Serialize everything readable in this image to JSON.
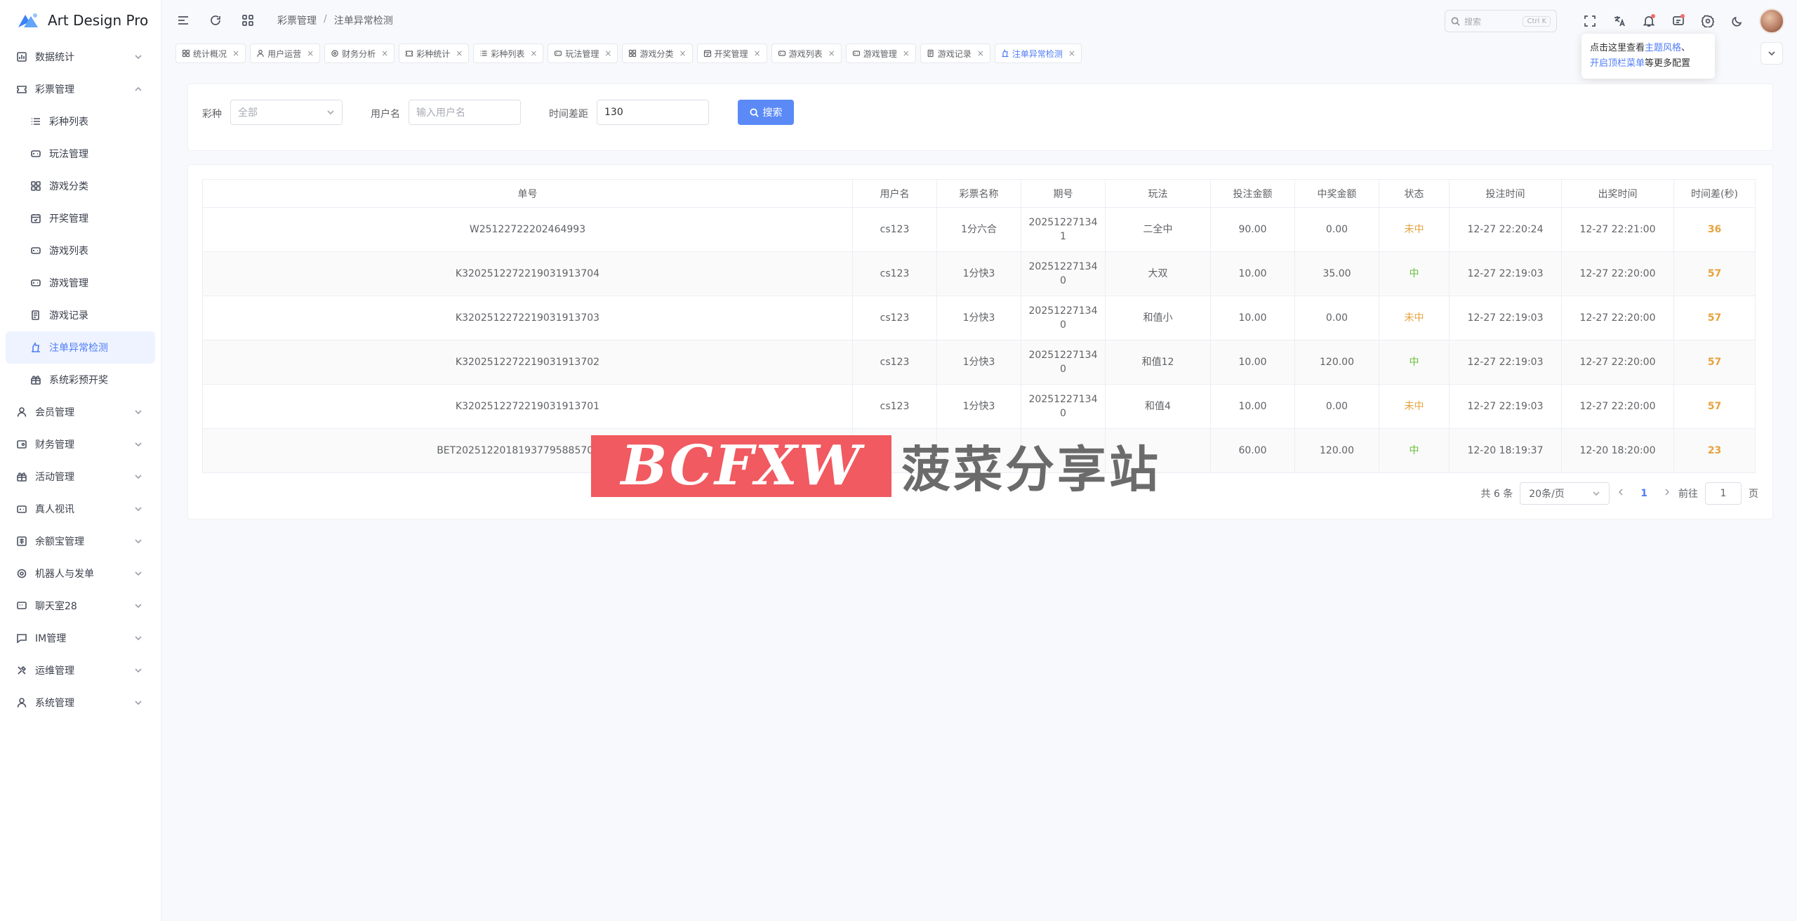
{
  "app": {
    "title": "Art Design Pro"
  },
  "colors": {
    "accent": "#4f7cf7",
    "win": "#67c23a",
    "lose": "#e6a23c"
  },
  "sidebar": {
    "items": [
      {
        "label": "数据统计",
        "icon": "chart-icon",
        "expandable": true
      },
      {
        "label": "彩票管理",
        "icon": "ticket-icon",
        "expandable": true,
        "expanded": true
      },
      {
        "label": "会员管理",
        "icon": "user-icon",
        "expandable": true
      },
      {
        "label": "财务管理",
        "icon": "wallet-icon",
        "expandable": true
      },
      {
        "label": "活动管理",
        "icon": "gift-icon",
        "expandable": true
      },
      {
        "label": "真人视讯",
        "icon": "video-icon",
        "expandable": true
      },
      {
        "label": "余额宝管理",
        "icon": "bank-icon",
        "expandable": true
      },
      {
        "label": "机器人与发单",
        "icon": "robot-icon",
        "expandable": true
      },
      {
        "label": "聊天室28",
        "icon": "chat-icon",
        "expandable": true
      },
      {
        "label": "IM管理",
        "icon": "message-icon",
        "expandable": true
      },
      {
        "label": "运维管理",
        "icon": "tools-icon",
        "expandable": true
      },
      {
        "label": "系统管理",
        "icon": "user-icon",
        "expandable": true
      }
    ],
    "sub_items": [
      {
        "label": "彩种列表",
        "icon": "list-icon"
      },
      {
        "label": "玩法管理",
        "icon": "gamepad-icon"
      },
      {
        "label": "游戏分类",
        "icon": "grid-icon"
      },
      {
        "label": "开奖管理",
        "icon": "calendar-icon"
      },
      {
        "label": "游戏列表",
        "icon": "gamepad-icon"
      },
      {
        "label": "游戏管理",
        "icon": "gamepad-icon"
      },
      {
        "label": "游戏记录",
        "icon": "record-icon"
      },
      {
        "label": "注单异常检测",
        "icon": "alert-icon",
        "active": true
      },
      {
        "label": "系统彩预开奖",
        "icon": "gift-icon"
      }
    ]
  },
  "header": {
    "breadcrumb": [
      "彩票管理",
      "注单异常检测"
    ],
    "breadcrumb_sep": "/",
    "search_placeholder": "搜索",
    "search_shortcut": "Ctrl K"
  },
  "tabs": [
    {
      "label": "统计概况"
    },
    {
      "label": "用户运营"
    },
    {
      "label": "财务分析"
    },
    {
      "label": "彩种统计"
    },
    {
      "label": "彩种列表"
    },
    {
      "label": "玩法管理"
    },
    {
      "label": "游戏分类"
    },
    {
      "label": "开奖管理"
    },
    {
      "label": "游戏列表"
    },
    {
      "label": "游戏管理"
    },
    {
      "label": "游戏记录"
    },
    {
      "label": "注单异常检测",
      "active": true
    }
  ],
  "tooltip": {
    "line1_pre": "点击这里查看",
    "line1_link": "主题风格",
    "line1_post": "、",
    "line2_link": "开启顶栏菜单",
    "line2_post": "等更多配置"
  },
  "filters": {
    "lottery_label": "彩种",
    "lottery_placeholder": "全部",
    "user_label": "用户名",
    "user_placeholder": "输入用户名",
    "diff_label": "时间差距",
    "diff_value": "130",
    "search_button": "搜索"
  },
  "table": {
    "headers": [
      "单号",
      "用户名",
      "彩票名称",
      "期号",
      "玩法",
      "投注金额",
      "中奖金额",
      "状态",
      "投注时间",
      "出奖时间",
      "时间差(秒)"
    ],
    "rows": [
      {
        "order": "W25122722202464993",
        "user": "cs123",
        "lottery": "1分六合",
        "issue1": "20251227134",
        "issue2": "1",
        "play": "二全中",
        "bet": "90.00",
        "win": "0.00",
        "status": "未中",
        "bet_time": "12-27 22:20:24",
        "draw_time": "12-27 22:21:00",
        "diff": "36"
      },
      {
        "order": "K3202512272219031913704",
        "user": "cs123",
        "lottery": "1分快3",
        "issue1": "20251227134",
        "issue2": "0",
        "play": "大双",
        "bet": "10.00",
        "win": "35.00",
        "status": "中",
        "bet_time": "12-27 22:19:03",
        "draw_time": "12-27 22:20:00",
        "diff": "57"
      },
      {
        "order": "K3202512272219031913703",
        "user": "cs123",
        "lottery": "1分快3",
        "issue1": "20251227134",
        "issue2": "0",
        "play": "和值小",
        "bet": "10.00",
        "win": "0.00",
        "status": "未中",
        "bet_time": "12-27 22:19:03",
        "draw_time": "12-27 22:20:00",
        "diff": "57"
      },
      {
        "order": "K3202512272219031913702",
        "user": "cs123",
        "lottery": "1分快3",
        "issue1": "20251227134",
        "issue2": "0",
        "play": "和值12",
        "bet": "10.00",
        "win": "120.00",
        "status": "中",
        "bet_time": "12-27 22:19:03",
        "draw_time": "12-27 22:20:00",
        "diff": "57"
      },
      {
        "order": "K3202512272219031913701",
        "user": "cs123",
        "lottery": "1分快3",
        "issue1": "20251227134",
        "issue2": "0",
        "play": "和值4",
        "bet": "10.00",
        "win": "0.00",
        "status": "未中",
        "bet_time": "12-27 22:19:03",
        "draw_time": "12-27 22:20:00",
        "diff": "57"
      },
      {
        "order": "BET20251220181937795885706554",
        "user": "",
        "lottery": "",
        "issue1": "",
        "issue2": "",
        "play": "",
        "bet": "60.00",
        "win": "120.00",
        "status": "中",
        "bet_time": "12-20 18:19:37",
        "draw_time": "12-20 18:20:00",
        "diff": "23"
      }
    ]
  },
  "pagination": {
    "total_text": "共 6 条",
    "page_size": "20条/页",
    "current": "1",
    "goto_label": "前往",
    "goto_value": "1",
    "page_suffix": "页"
  },
  "watermark": {
    "logo_text": "BCFXW",
    "text": "菠菜分享站"
  }
}
